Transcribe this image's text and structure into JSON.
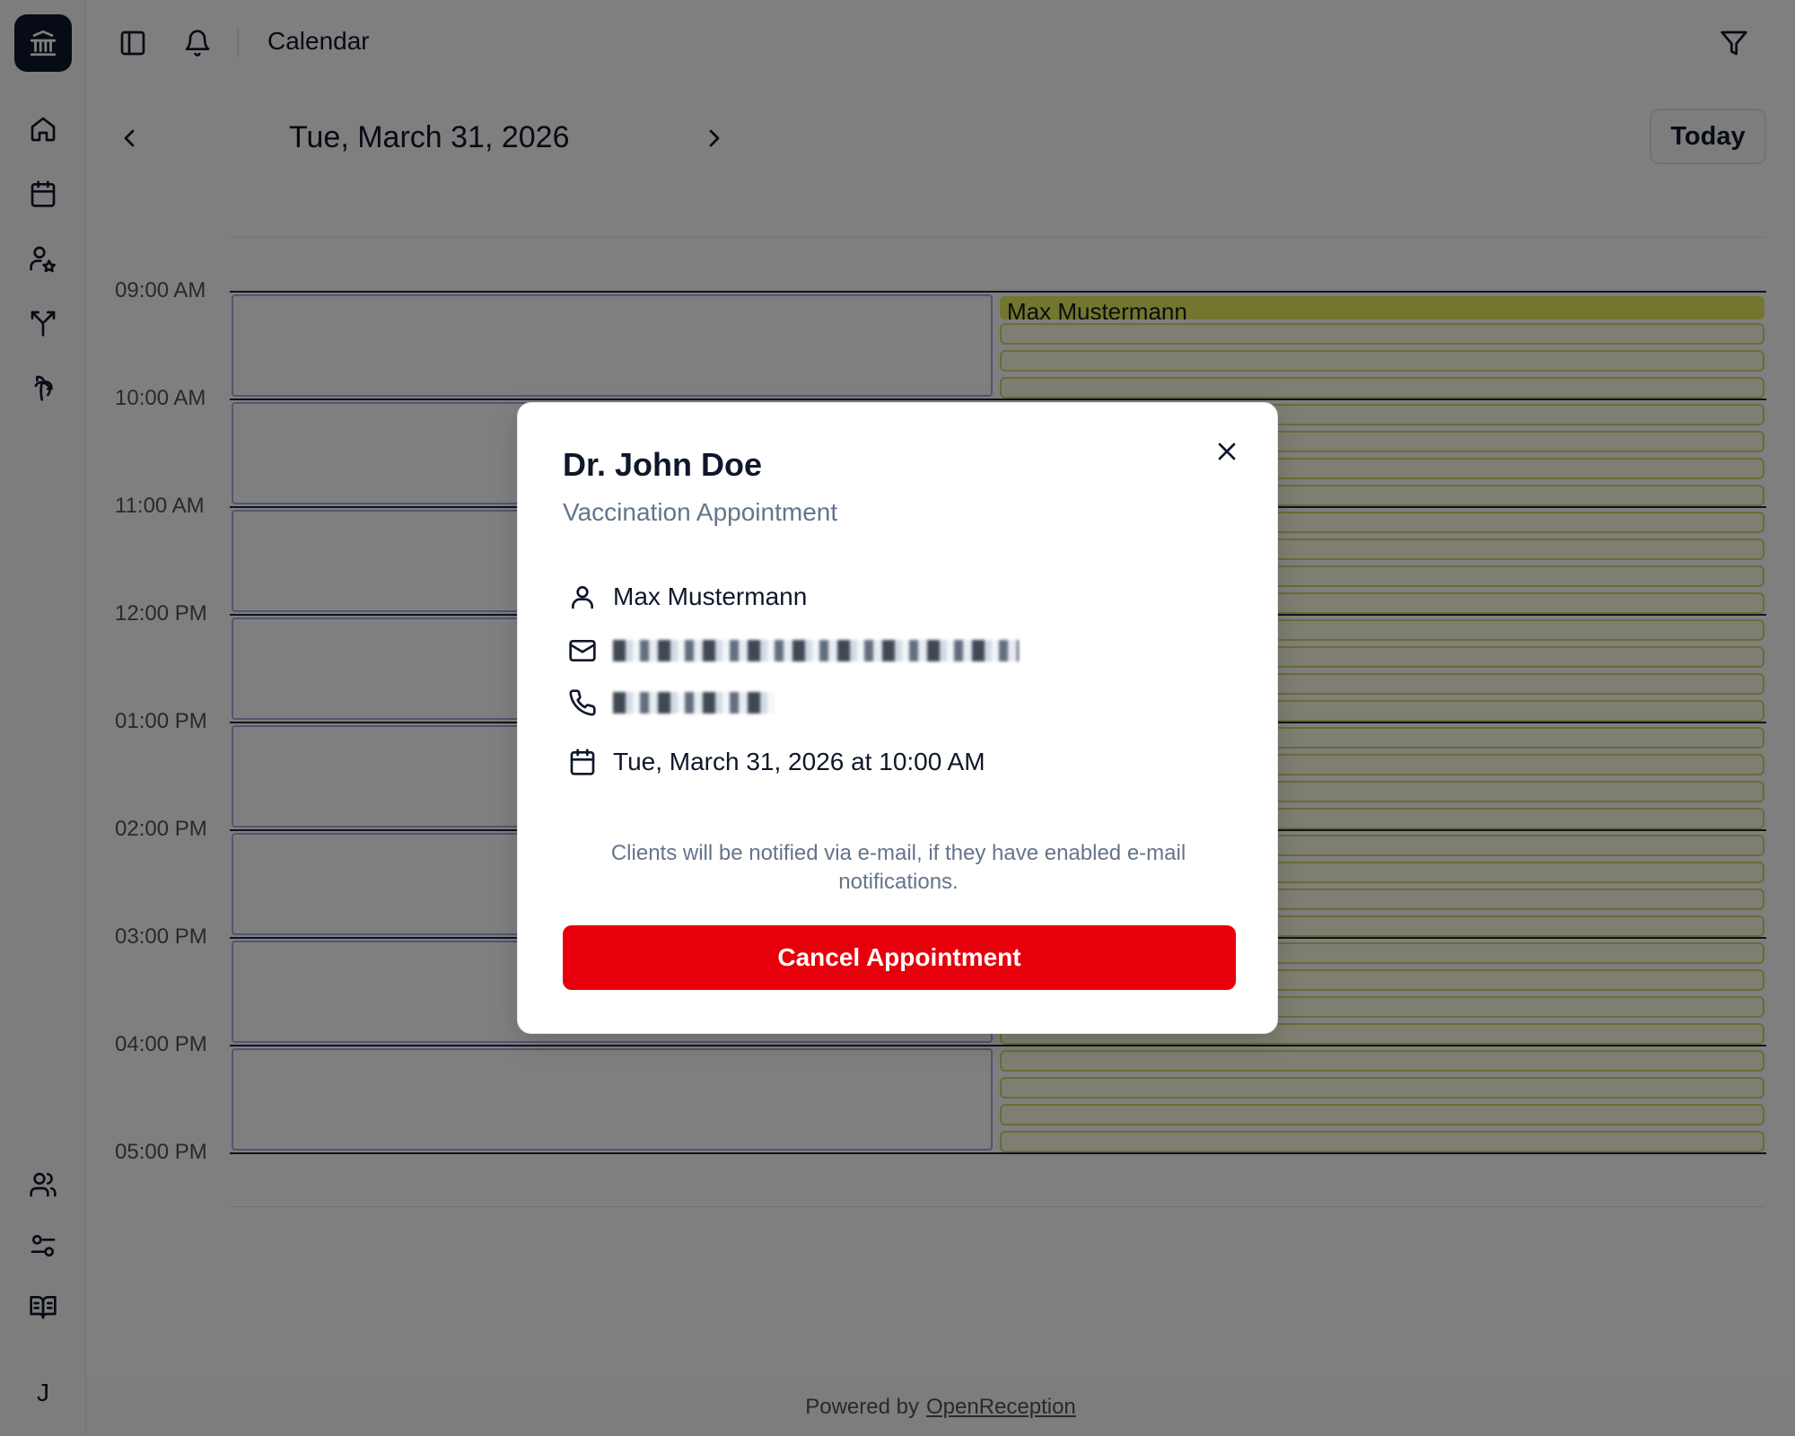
{
  "header": {
    "title": "Calendar"
  },
  "date_nav": {
    "current_date": "Tue, March 31, 2026",
    "today_label": "Today"
  },
  "calendar": {
    "hours": [
      "09:00 AM",
      "10:00 AM",
      "11:00 AM",
      "12:00 PM",
      "01:00 PM",
      "02:00 PM",
      "03:00 PM",
      "04:00 PM",
      "05:00 PM"
    ],
    "first_event_name": "Max Mustermann"
  },
  "sidebar": {
    "avatar_initial": "J",
    "icons": [
      "bank-icon",
      "home-icon",
      "calendar-icon",
      "user-star-icon",
      "split-icon",
      "palm-tree-icon",
      "users-icon",
      "sliders-icon",
      "book-icon"
    ]
  },
  "footer": {
    "powered_by": "Powered by",
    "brand": "OpenReception"
  },
  "modal": {
    "title": "Dr. John Doe",
    "subtitle": "Vaccination Appointment",
    "client_name": "Max Mustermann",
    "appointment_time": "Tue, March 31, 2026 at 10:00 AM",
    "notice": "Clients will be notified via e-mail, if they have enabled e-mail notifications.",
    "cancel_label": "Cancel Appointment"
  },
  "colors": {
    "danger": "#e7000b",
    "slot_border": "#a5abe0",
    "event_fill": "#e6ec5c",
    "event_border": "#d4d86a"
  }
}
